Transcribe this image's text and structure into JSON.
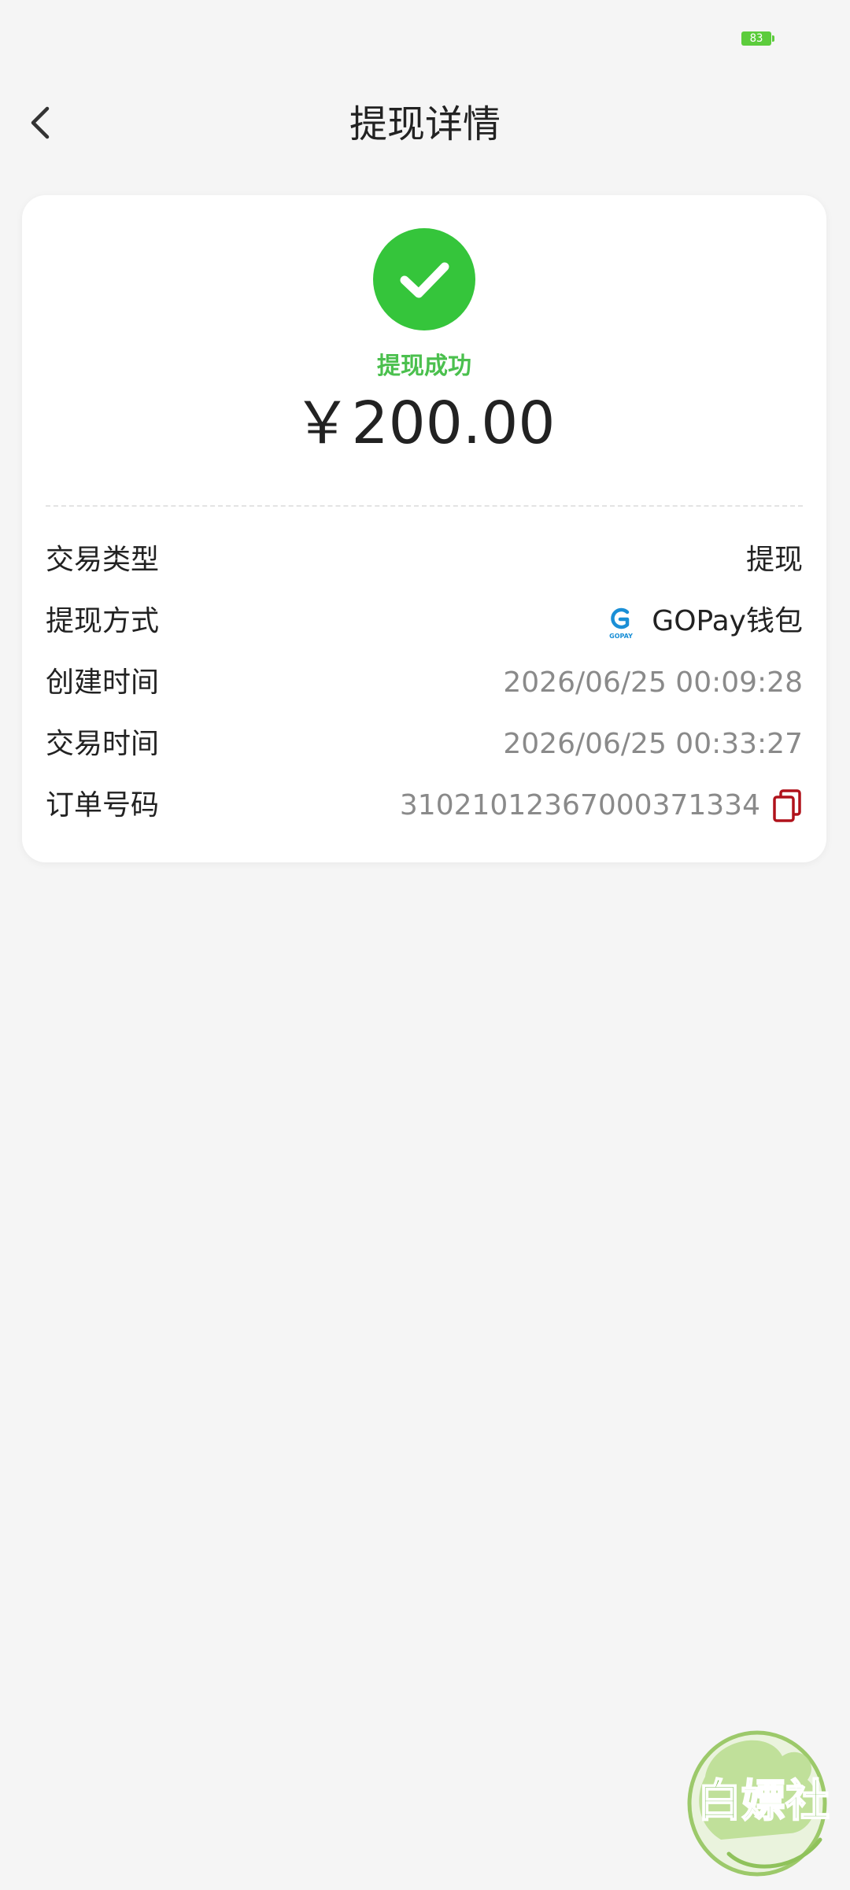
{
  "status_bar": {
    "battery": "83"
  },
  "header": {
    "title": "提现详情"
  },
  "result": {
    "status_text": "提现成功",
    "amount": "￥200.00"
  },
  "details": {
    "transaction_type": {
      "label": "交易类型",
      "value": "提现"
    },
    "method": {
      "label": "提现方式",
      "value": "GOPay钱包",
      "logo_text": "GOPAY"
    },
    "created_time": {
      "label": "创建时间",
      "value": "2026/06/25 00:09:28"
    },
    "transaction_time": {
      "label": "交易时间",
      "value": "2026/06/25 00:33:27"
    },
    "order_number": {
      "label": "订单号码",
      "value": "31021012367000371334"
    }
  },
  "watermark": {
    "text": "白嫖社"
  },
  "colors": {
    "success_green": "#35c53b",
    "status_text_green": "#4bc04e",
    "copy_icon_red": "#b0121b",
    "gopay_blue": "#1a8fd6"
  }
}
